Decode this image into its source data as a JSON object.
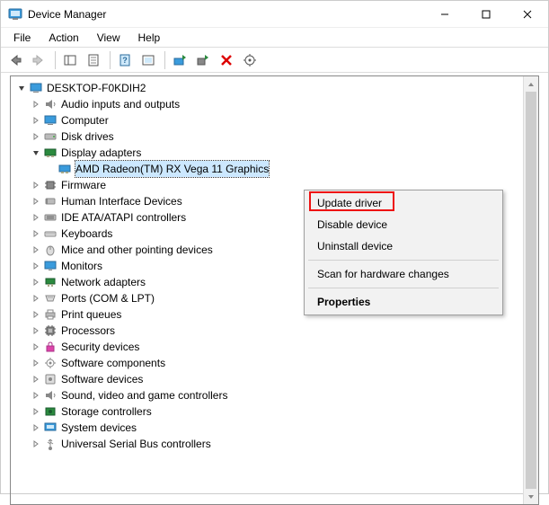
{
  "window": {
    "title": "Device Manager"
  },
  "menubar": {
    "file": "File",
    "action": "Action",
    "view": "View",
    "help": "Help"
  },
  "tree": {
    "root": "DESKTOP-F0KDIH2",
    "audio": "Audio inputs and outputs",
    "computer": "Computer",
    "disk": "Disk drives",
    "display": "Display adapters",
    "display_child": "AMD Radeon(TM) RX Vega 11 Graphics",
    "firmware": "Firmware",
    "hid": "Human Interface Devices",
    "ide": "IDE ATA/ATAPI controllers",
    "keyboards": "Keyboards",
    "mice": "Mice and other pointing devices",
    "monitors": "Monitors",
    "network": "Network adapters",
    "ports": "Ports (COM & LPT)",
    "printq": "Print queues",
    "processors": "Processors",
    "security": "Security devices",
    "swcomp": "Software components",
    "swdev": "Software devices",
    "sound": "Sound, video and game controllers",
    "storage": "Storage controllers",
    "system": "System devices",
    "usb": "Universal Serial Bus controllers"
  },
  "context_menu": {
    "update": "Update driver",
    "disable": "Disable device",
    "uninstall": "Uninstall device",
    "scan": "Scan for hardware changes",
    "properties": "Properties"
  }
}
